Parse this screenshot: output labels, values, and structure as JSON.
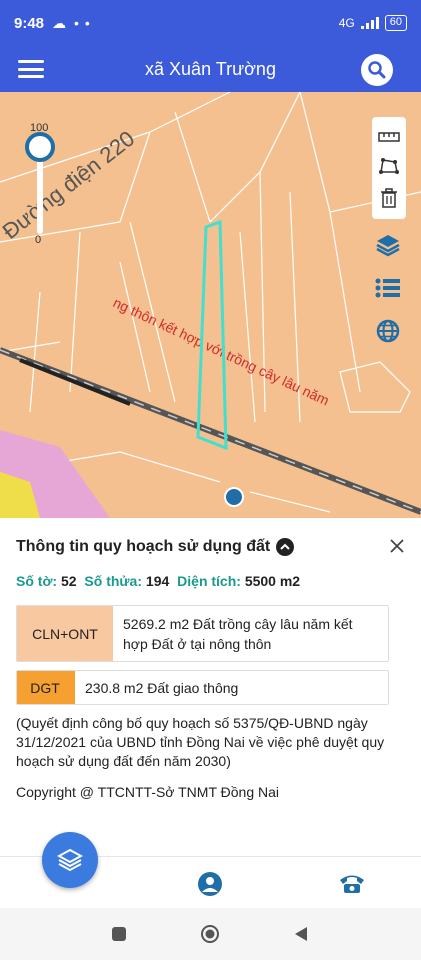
{
  "status_bar": {
    "time": "9:48",
    "dots": "• •",
    "network": "4G",
    "battery": "60"
  },
  "app_bar": {
    "title": "xã Xuân Trường"
  },
  "map": {
    "road_label": "Đường điện 220",
    "zone_label": "ng thôn kết hợp với trồng cây lâu năm",
    "zoom_max": "100",
    "zoom_min": "0",
    "zoom_value": 100
  },
  "info": {
    "title": "Thông tin quy hoạch sử dụng đất",
    "so_to_label": "Số tờ:",
    "so_to": "52",
    "so_thua_label": "Số thửa:",
    "so_thua": "194",
    "dien_tich_label": "Diện tích:",
    "dien_tich": "5500 m2",
    "zones": [
      {
        "code": "CLN+ONT",
        "desc": "5269.2 m2 Đất trồng cây lâu năm kết hợp Đất ở tại nông thôn"
      },
      {
        "code": "DGT",
        "desc": "230.8 m2 Đất giao thông"
      }
    ],
    "note": "(Quyết định công bố quy hoạch số 5375/QĐ-UBND ngày 31/12/2021 của UBND tỉnh Đồng Nai về việc phê duyệt quy hoạch sử dụng đất đến năm 2030)",
    "copyright": "Copyright @ TTCNTT-Sở TNMT Đồng Nai"
  },
  "colors": {
    "primary": "#3b5bdb",
    "teal": "#1a9a8f",
    "zone_orange": "#f8c9a0",
    "dgt_orange": "#f5a030",
    "map_base": "#f4c08f",
    "parcel_outline": "#40e0d0"
  }
}
